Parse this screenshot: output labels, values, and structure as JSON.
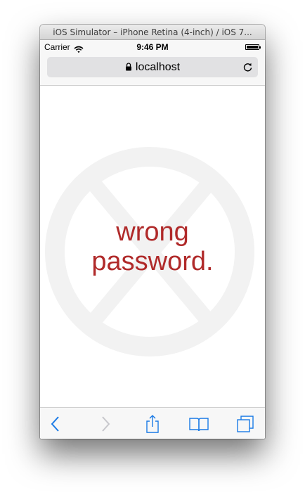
{
  "window": {
    "title": "iOS Simulator – iPhone Retina (4-inch) / iOS 7..."
  },
  "status_bar": {
    "carrier": "Carrier",
    "time": "9:46 PM",
    "icons": [
      "wifi-icon",
      "battery-icon"
    ]
  },
  "address_bar": {
    "url": "localhost",
    "icons": [
      "lock-icon",
      "reload-icon"
    ]
  },
  "page": {
    "message_line1": "wrong",
    "message_line2": "password.",
    "message_color": "#b02a2a",
    "background_icon": "prohibited-icon"
  },
  "toolbar": {
    "items": [
      {
        "name": "back",
        "icon": "chevron-left-icon",
        "enabled": true
      },
      {
        "name": "forward",
        "icon": "chevron-right-icon",
        "enabled": false
      },
      {
        "name": "share",
        "icon": "share-icon",
        "enabled": true
      },
      {
        "name": "bookmarks",
        "icon": "book-icon",
        "enabled": true
      },
      {
        "name": "tabs",
        "icon": "tabs-icon",
        "enabled": true
      }
    ],
    "tint_color": "#1a7ae6",
    "disabled_color": "#c7c7cc"
  }
}
